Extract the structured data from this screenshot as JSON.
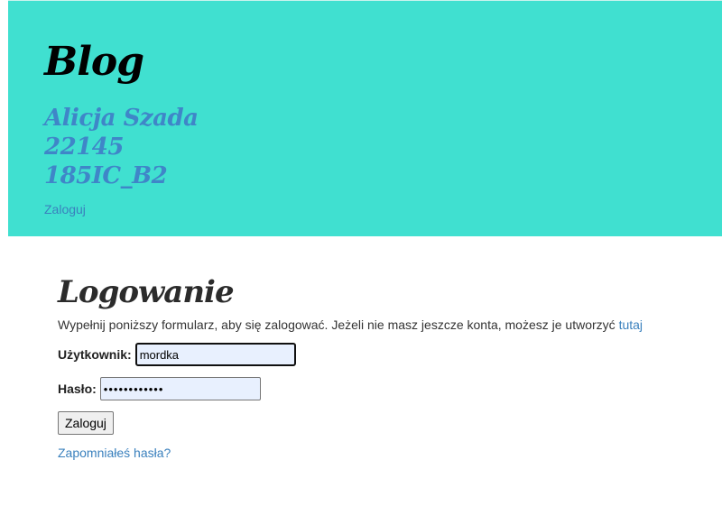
{
  "header": {
    "blog_title": "Blog",
    "author_lines": [
      "Alicja Szada",
      "22145",
      "185IC_B2"
    ],
    "login_link": "Zaloguj",
    "background_color": "#40e0d0",
    "accent_color": "#3f86c8"
  },
  "login": {
    "heading": "Logowanie",
    "instructions": "Wypełnij poniższy formularz, aby się zalogować. Jeżeli nie masz jeszcze konta, możesz je utworzyć",
    "register_link": "tutaj",
    "username_label": "Użytkownik:",
    "username_value": "mordka",
    "password_label": "Hasło:",
    "password_value": "••••••••••••",
    "submit_label": "Zaloguj",
    "forgot_link": "Zapomniałeś hasła?"
  }
}
